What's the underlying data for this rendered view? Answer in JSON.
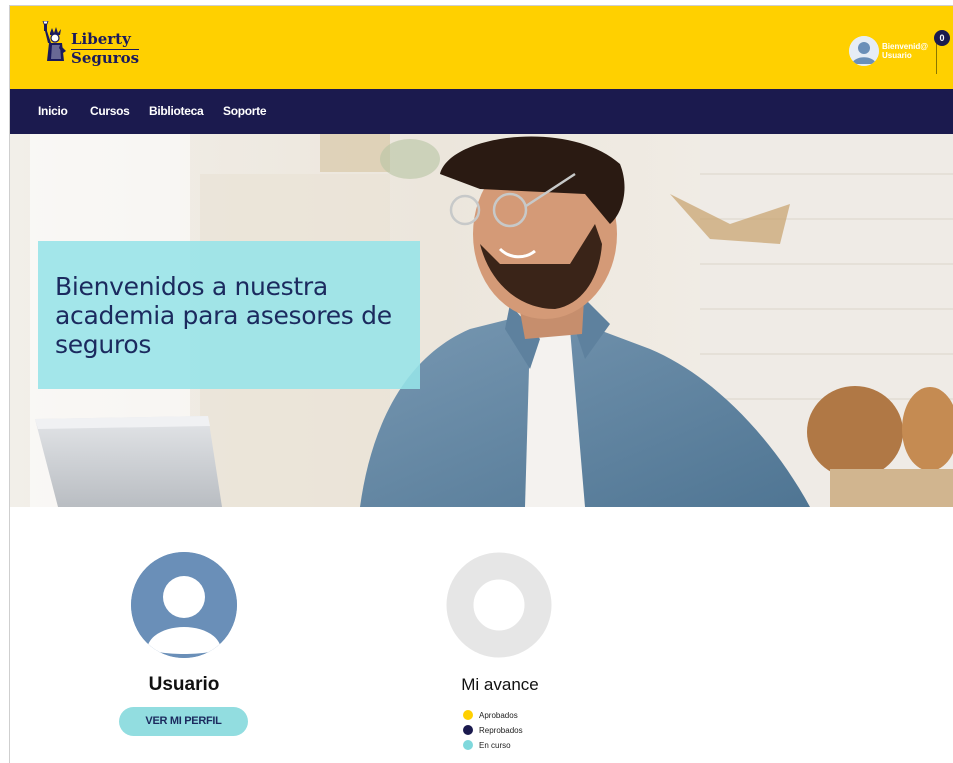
{
  "brand": {
    "logo_line1": "Liberty",
    "logo_line2": "Seguros",
    "primary_color": "#ffd000",
    "nav_color": "#1b1a4e",
    "accent_color": "#92dde0"
  },
  "header": {
    "greeting_line1": "Bienvenid@",
    "greeting_line2": "Usuario",
    "notification_count": "0",
    "user_icon": "user-avatar-icon"
  },
  "nav": {
    "items": [
      {
        "label": "Inicio"
      },
      {
        "label": "Cursos"
      },
      {
        "label": "Biblioteca"
      },
      {
        "label": "Soporte"
      }
    ]
  },
  "hero": {
    "title": "Bienvenidos a nuestra academia para asesores de seguros"
  },
  "profile": {
    "name": "Usuario",
    "button_label": "VER MI PERFIL"
  },
  "progress": {
    "title": "Mi avance",
    "legend": [
      {
        "label": "Aprobados",
        "color": "#ffd000"
      },
      {
        "label": "Reprobados",
        "color": "#1b1a4e"
      },
      {
        "label": "En curso",
        "color": "#7fd8dc"
      }
    ]
  }
}
